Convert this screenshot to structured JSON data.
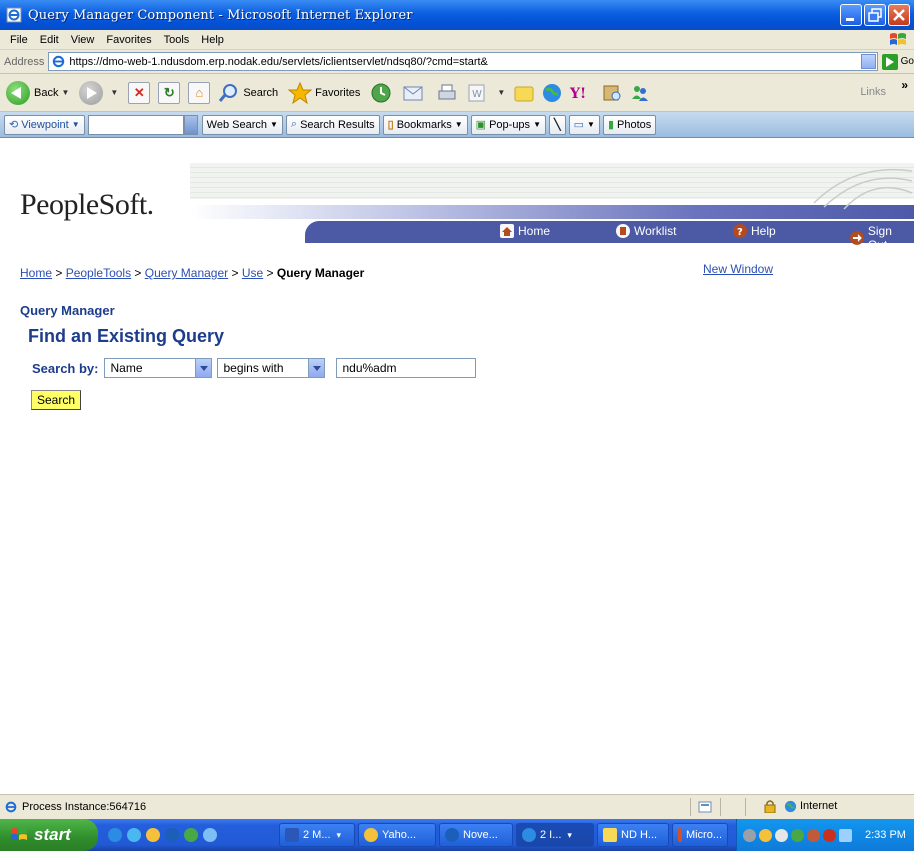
{
  "window": {
    "title": "Query Manager Component - Microsoft Internet Explorer"
  },
  "menu": [
    "File",
    "Edit",
    "View",
    "Favorites",
    "Tools",
    "Help"
  ],
  "address": {
    "label": "Address",
    "url": "https://dmo-web-1.ndusdom.erp.nodak.edu/servlets/iclientservlet/ndsq80/?cmd=start&",
    "go_label": "Go"
  },
  "toolbar": {
    "back_label": "Back",
    "search_label": "Search",
    "favorites_label": "Favorites",
    "links_label": "Links"
  },
  "viewpoint_bar": {
    "viewpoint_label": "Viewpoint",
    "web_search_label": "Web Search",
    "search_results_label": "Search Results",
    "bookmarks_label": "Bookmarks",
    "popups_label": "Pop-ups",
    "photos_label": "Photos"
  },
  "peoplesoft": {
    "logo": "PeopleSoft.",
    "nav": {
      "home": "Home",
      "worklist": "Worklist",
      "help": "Help",
      "sign_out": "Sign Out"
    },
    "breadcrumb": {
      "home": "Home",
      "peopletools": "PeopleTools",
      "query_manager": "Query Manager",
      "use": "Use",
      "current": "Query Manager",
      "separator": " > "
    },
    "new_window": "New Window",
    "page_title": "Query Manager",
    "section_title": "Find an Existing Query",
    "search_by_label": "Search by:",
    "search_by_value": "Name",
    "operator_value": "begins with",
    "search_text": "ndu%adm",
    "search_button": "Search"
  },
  "statusbar": {
    "text": "Process Instance:564716",
    "zone": "Internet"
  },
  "taskbar": {
    "start_label": "start",
    "tasks": [
      {
        "label": "2 M...",
        "caret": "▾"
      },
      {
        "label": "Yaho..."
      },
      {
        "label": "Nove..."
      },
      {
        "label": "2 I...",
        "caret": "▾"
      },
      {
        "label": "ND H..."
      },
      {
        "label": "Micro..."
      }
    ],
    "clock": "2:33 PM"
  },
  "colors": {
    "ps_nav": "#4c5aa6",
    "ps_title": "#1c3c8c",
    "link": "#2c4fb3",
    "search_button_bg": "#ffff66"
  }
}
